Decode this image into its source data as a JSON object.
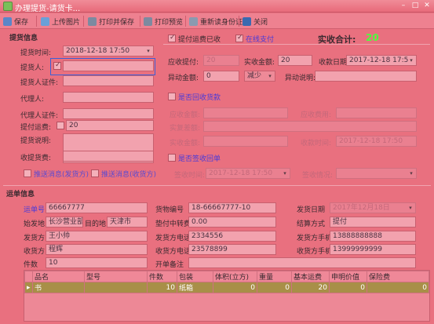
{
  "window": {
    "title": "办理提货-请货卡...",
    "minimize": "–",
    "maximize": "□",
    "close": "✕"
  },
  "toolbar": [
    {
      "label": "保存",
      "icon": "save-icon",
      "color": "#5a86c8"
    },
    {
      "label": "上传图片",
      "icon": "image-upload-icon",
      "color": "#6aa0d8"
    },
    {
      "label": "打印并保存",
      "icon": "print-icon",
      "color": "#7d8aa0"
    },
    {
      "label": "打印预览",
      "icon": "print-preview-icon",
      "color": "#7d8aa0"
    },
    {
      "label": "重新读身份证",
      "icon": "id-card-icon",
      "color": "#8a9ab0"
    },
    {
      "label": "关闭",
      "icon": "close-icon",
      "color": "#3a6ab0"
    }
  ],
  "pickup": {
    "section_title": "提货信息",
    "time_label": "提货时间:",
    "time_value": "2018-12-18 17:50",
    "person_label": "提货人:",
    "person_value": "",
    "id_label": "提货人证件:",
    "id_value": "",
    "agent_label": "代理人:",
    "agent_value": "",
    "agent_id_label": "代理人证件:",
    "agent_id_value": "",
    "freight_label": "提付运费:",
    "freight_value": "20",
    "desc_label": "提货说明:",
    "desc_value": "",
    "fee_label": "收提货费:",
    "fee_value": "",
    "notify_shipper": "推送消息(发货方)",
    "notify_receiver": "推送消息(收货方)"
  },
  "payment": {
    "freight_received": "提付运费已收",
    "online_pay": "在线支付",
    "total_label": "实收合计:",
    "total_value": "20",
    "due_label": "应收提付:",
    "due_value": "20",
    "actual_label": "实收金额:",
    "actual_value": "20",
    "date_label": "收款日期",
    "date_value": "2017-12-18 17:5",
    "abnormal_label": "异动金额:",
    "abnormal_value": "0",
    "reduce_value": "减少",
    "abnormal_desc_label": "异动说明:",
    "abnormal_desc_value": "",
    "cod_check": "是否回收货款",
    "cod_due_label": "应收金额:",
    "cod_due_value": "",
    "cod_fee_label": "应收费用:",
    "cod_fee_value": "",
    "cod_diff_label": "实复差额:",
    "cod_diff_value": "",
    "cod_actual_label": "实收金额:",
    "cod_actual_value": "",
    "cod_time_label": "收款时间:",
    "cod_time_value": "2017-12-18 17:50",
    "sign_check": "是否签收回单",
    "sign_time_label": "签收时间:",
    "sign_time_value": "2017-12-18 17:50",
    "sign_status_label": "签收情况:",
    "sign_status_value": ""
  },
  "waybill": {
    "section_title": "运单信息",
    "no_label": "运单号",
    "no_value": "66667777",
    "goods_no_label": "货物编号",
    "goods_no_value": "18-66667777-10",
    "ship_date_label": "发货日期",
    "ship_date_value": "2017年12月18日",
    "origin_label": "始发地",
    "origin_value": "长沙营业部",
    "dest_label": "目的地",
    "dest_value": "天津市",
    "transfer_label": "垫付中转费",
    "transfer_value": "0.00",
    "settle_label": "结算方式",
    "settle_value": "提付",
    "shipper_label": "发货方",
    "shipper_value": "王小帅",
    "shipper_phone_label": "发货方电话",
    "shipper_phone_value": "2334556",
    "shipper_mobile_label": "发货方手机",
    "shipper_mobile_value": "13888888888",
    "receiver_label": "收货方",
    "receiver_value": "程辉",
    "receiver_phone_label": "收货方电话",
    "receiver_phone_value": "23578899",
    "receiver_mobile_label": "收货方手机",
    "receiver_mobile_value": "13999999999",
    "pieces_label": "件数",
    "pieces_value": "10",
    "remark_label": "开单备注",
    "remark_value": ""
  },
  "goods_table": {
    "columns": [
      "品名",
      "型号",
      "件数",
      "包装",
      "体积(立方)",
      "重量",
      "基本运费",
      "申明价值",
      "保险费"
    ],
    "rows": [
      {
        "marker": "▸",
        "cells": [
          "书",
          "",
          "10",
          "纸箱",
          "0",
          "0",
          "20",
          "0",
          "0"
        ]
      }
    ]
  }
}
